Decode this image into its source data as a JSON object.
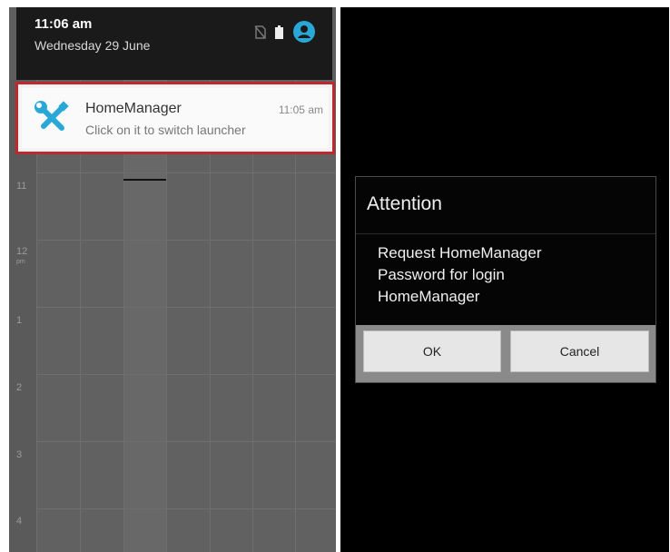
{
  "left_screen": {
    "status": {
      "time": "11:06 am",
      "date": "Wednesday 29 June",
      "icons": [
        "sim-card-off-icon",
        "battery-icon",
        "account-circle-icon"
      ]
    },
    "notification": {
      "app_icon": "wrench-screwdriver-icon",
      "title": "HomeManager",
      "time": "11:05 am",
      "text": "Click on it to switch launcher"
    },
    "calendar": {
      "hour_labels": [
        "11",
        "12",
        "1",
        "2",
        "3",
        "4"
      ],
      "pm_label": "pm"
    }
  },
  "right_screen": {
    "dialog": {
      "title": "Attention",
      "message_lines": [
        "Request HomeManager",
        "Password for login",
        "HomeManager"
      ],
      "ok_label": "OK",
      "cancel_label": "Cancel"
    }
  },
  "colors": {
    "highlight_border": "#c0282d",
    "icon_accent": "#29a8d8"
  }
}
